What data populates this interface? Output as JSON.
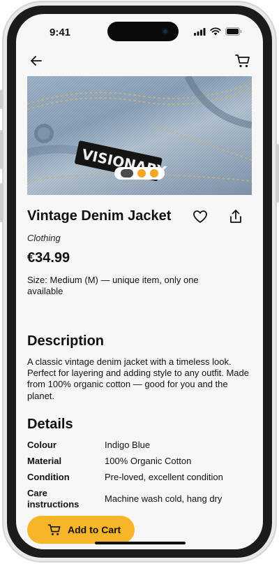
{
  "status": {
    "time": "9:41"
  },
  "product": {
    "name": "Vintage Denim Jacket",
    "category": "Clothing",
    "price": "€34.99",
    "size": "Size: Medium (M) — unique item, only one available",
    "patch_text": "VISIONARY",
    "carousel": {
      "count": 3,
      "active_index": 0
    }
  },
  "description": {
    "heading": "Description",
    "text": "A classic vintage denim jacket with a timeless look. Perfect for layering and adding style to any outfit. Made from 100% organic cotton — good for you and the planet."
  },
  "details": {
    "heading": "Details",
    "rows": [
      {
        "label": "Colour",
        "value": "Indigo Blue"
      },
      {
        "label": "Material",
        "value": "100% Organic Cotton"
      },
      {
        "label": "Condition",
        "value": "Pre-loved, excellent condition"
      },
      {
        "label": "Care instructions",
        "value": "Machine wash cold, hang dry"
      }
    ]
  },
  "actions": {
    "add_to_cart": "Add to Cart"
  },
  "icons": {
    "back": "arrow-left-icon",
    "cart": "cart-icon",
    "favorite": "heart-icon",
    "share": "share-icon"
  },
  "colors": {
    "accent": "#f7b52a",
    "dot_active": "#4b4b4b",
    "dot_inactive": "#f5a623"
  }
}
